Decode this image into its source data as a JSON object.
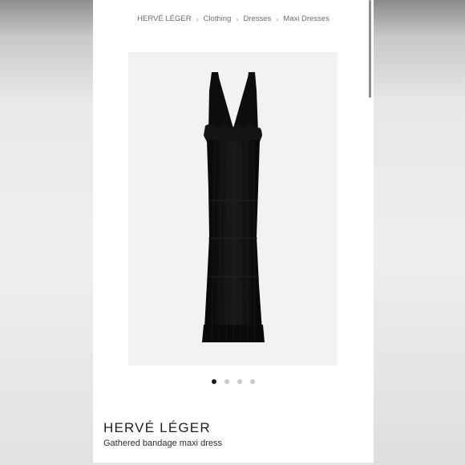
{
  "breadcrumb": {
    "items": [
      "HERVÉ LÉGER",
      "Clothing",
      "Dresses",
      "Maxi Dresses"
    ],
    "separator": "›"
  },
  "gallery": {
    "image_icon": "black-maxi-dress-image",
    "image_count": 4,
    "active_index": 0
  },
  "product": {
    "brand": "HERVÉ LÉGER",
    "name": "Gathered bandage maxi dress"
  },
  "colors": {
    "dress": "#0d0d0d",
    "image_background": "#f2f2f2",
    "active_dot": "#1a1a1a",
    "inactive_dot": "#c9c9c9"
  }
}
